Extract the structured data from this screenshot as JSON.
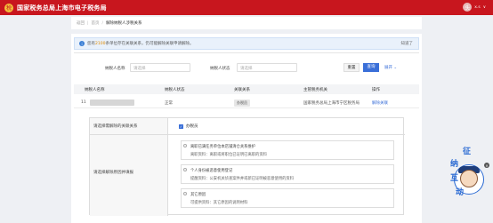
{
  "header": {
    "emblem_glyph": "税",
    "title": "国家税务总局上海市电子税务局",
    "avatar_glyph": "头",
    "username": "x.s",
    "chevron": "∨"
  },
  "breadcrumb": {
    "back": "返回",
    "home": "首页",
    "current": "解除纳税人涉税关系"
  },
  "notice": {
    "icon": "i",
    "prefix": "您有 ",
    "count": "2100",
    "suffix": " 条单位存在关联关系，仍可能解除关联申请解除。",
    "dismiss": "知道了"
  },
  "filters": {
    "name_label": "纳税人名称",
    "name_placeholder": "请选择",
    "status_label": "纳税人状态",
    "status_placeholder": "请选择",
    "reset": "重置",
    "query": "查询",
    "expand": "展开 ⌄"
  },
  "table": {
    "headers": [
      "纳税人名称",
      "纳税人状态",
      "关联关系",
      "主管税务机关",
      "操作"
    ],
    "rows": [
      {
        "index": "11",
        "status": "正常",
        "relation": "办税员",
        "authority": "国家税务总局上海市宁区税务局",
        "action": "解除关联"
      }
    ]
  },
  "detail": {
    "relation_label": "请选择需解除的关联关系",
    "relation_value": "办税员",
    "checkbox_glyph": "✓",
    "options_label": "请选择解除原因并填报",
    "options": [
      {
        "title": "离职已满任务单位本店铺清仓关系维护",
        "sub": "离职资料：离职或将职位已证明已离职的资料"
      },
      {
        "title": "个人身份被恶意使用登记",
        "sub": "提醒资料：公安机关侦查案件并或新已证明被恶意使用的资料"
      },
      {
        "title": "其它原因",
        "sub": "可提供资料：其它原因的说明材料"
      }
    ]
  },
  "mascot": {
    "chars": [
      "征",
      "纳",
      "互",
      "动"
    ],
    "close": "×"
  }
}
